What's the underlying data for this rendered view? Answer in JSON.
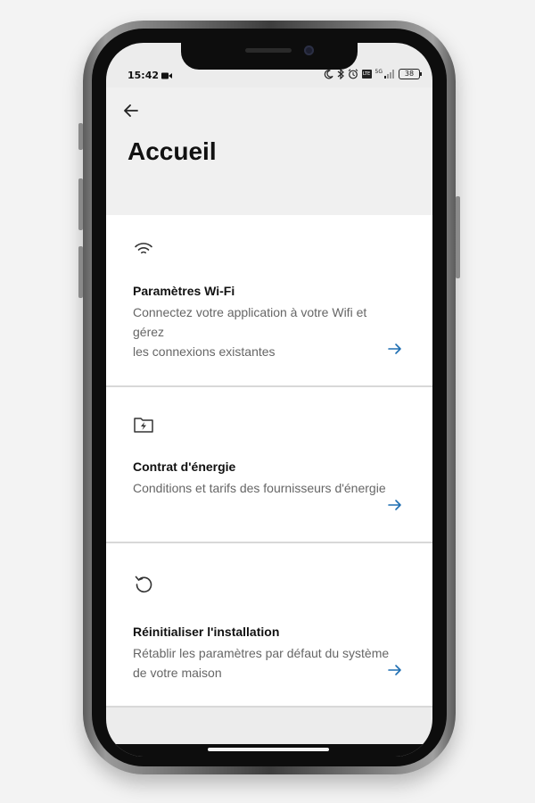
{
  "status_bar": {
    "time": "15:42",
    "lte_label": "LTE",
    "network_label": "5G",
    "battery_level": "38"
  },
  "header": {
    "back_icon": "arrow-left-icon",
    "title": "Accueil"
  },
  "cards": [
    {
      "icon": "wifi-icon",
      "title": "Paramètres Wi-Fi",
      "description": "Connectez votre application à votre Wifi et gérez\nles connexions existantes",
      "arrow_icon": "arrow-right-icon"
    },
    {
      "icon": "energy-contract-icon",
      "title": "Contrat d'énergie",
      "description": "Conditions et tarifs des fournisseurs d'énergie",
      "arrow_icon": "arrow-right-icon"
    },
    {
      "icon": "reset-icon",
      "title": "Réinitialiser l'installation",
      "description": "Rétablir les paramètres par défaut du système de votre maison",
      "arrow_icon": "arrow-right-icon"
    }
  ],
  "colors": {
    "accent": "#1f6fb2",
    "header_bg": "#f0f0f0",
    "card_bg": "#ffffff",
    "title_text": "#111111",
    "description_text": "#666666"
  }
}
